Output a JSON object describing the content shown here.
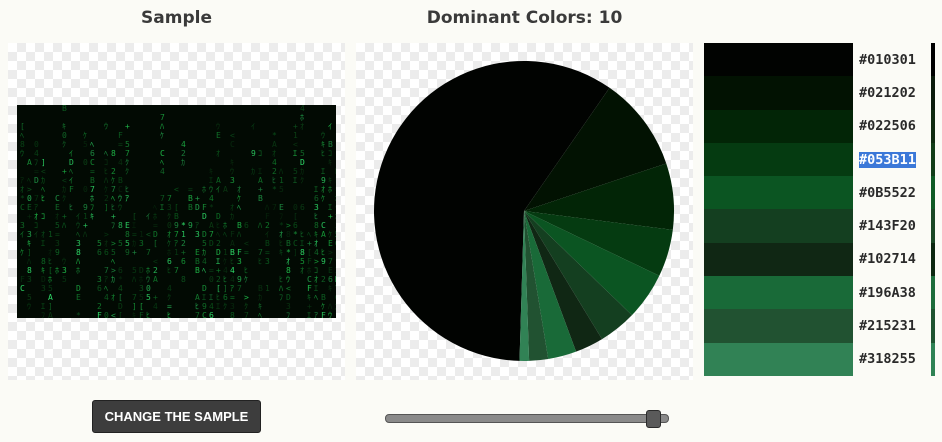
{
  "sample": {
    "title": "Sample",
    "button_label": "CHANGE THE SAMPLE"
  },
  "pie": {
    "title": "Dominant Colors: 10",
    "slices": [
      {
        "color": "#010301",
        "value": 58
      },
      {
        "color": "#021202",
        "value": 10
      },
      {
        "color": "#022506",
        "value": 7
      },
      {
        "color": "#053B11",
        "value": 5
      },
      {
        "color": "#0B5522",
        "value": 5
      },
      {
        "color": "#143F20",
        "value": 4
      },
      {
        "color": "#102714",
        "value": 3
      },
      {
        "color": "#196A38",
        "value": 3
      },
      {
        "color": "#215231",
        "value": 2
      },
      {
        "color": "#318255",
        "value": 1
      }
    ]
  },
  "palette": {
    "colors": [
      {
        "hex": "#010301",
        "label": "#010301",
        "edge": "#000000"
      },
      {
        "hex": "#021202",
        "label": "#021202",
        "edge": "#0a1a0a"
      },
      {
        "hex": "#022506",
        "label": "#022506",
        "edge": "#0f2a10"
      },
      {
        "hex": "#053B11",
        "label": "#053B11",
        "edge": "#123d18"
      },
      {
        "hex": "#0B5522",
        "label": "#0B5522",
        "edge": "#0f5a24"
      },
      {
        "hex": "#143F20",
        "label": "#143F20",
        "edge": "#1a4725"
      },
      {
        "hex": "#102714",
        "label": "#102714",
        "edge": "#0c2710"
      },
      {
        "hex": "#196A38",
        "label": "#196A38",
        "edge": "#1d6d3b"
      },
      {
        "hex": "#215231",
        "label": "#215231",
        "edge": "#1f5330"
      },
      {
        "hex": "#318255",
        "label": "#318255",
        "edge": "#2f8254"
      }
    ],
    "selected_index": 3
  },
  "slider": {
    "value_fraction": 0.97
  }
}
